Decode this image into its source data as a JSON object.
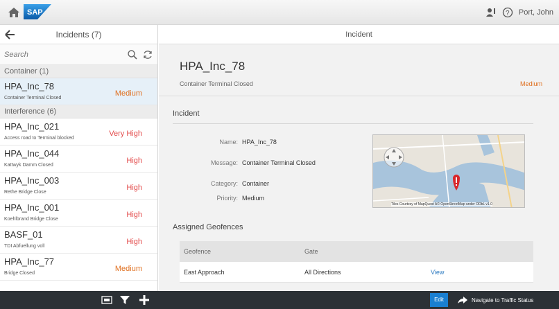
{
  "shell": {
    "logo_text": "SAP",
    "user_name": "Port, John",
    "icons": [
      "home-icon",
      "user-notification-icon",
      "help-icon"
    ]
  },
  "master": {
    "title": "Incidents (7)",
    "search_placeholder": "Search",
    "groups": [
      {
        "label": "Container (1)",
        "items": [
          {
            "title": "HPA_Inc_78",
            "desc": "Container Terminal Closed",
            "priority": "Medium",
            "selected": true
          }
        ]
      },
      {
        "label": "Interference (6)",
        "items": [
          {
            "title": "HPA_Inc_021",
            "desc": "Access road to Terminal blocked",
            "priority": "Very High"
          },
          {
            "title": "HPA_Inc_044",
            "desc": "Kattwyk Damm Closed",
            "priority": "High"
          },
          {
            "title": "HPA_Inc_003",
            "desc": "Rethe Bridge Close",
            "priority": "High"
          },
          {
            "title": "HPA_Inc_001",
            "desc": "Koehlbrand Bridge Close",
            "priority": "High"
          },
          {
            "title": "BASF_01",
            "desc": "TDI Abfuellung voll",
            "priority": "High"
          },
          {
            "title": "HPA_Inc_77",
            "desc": "Bridge Closed",
            "priority": "Medium"
          }
        ]
      }
    ]
  },
  "detail": {
    "header": "Incident",
    "title": "HPA_Inc_78",
    "subtitle": "Container Terminal Closed",
    "priority": "Medium",
    "section_incident": "Incident",
    "fields": {
      "name_label": "Name:",
      "name_value": "HPA_Inc_78",
      "message_label": "Message:",
      "message_value": "Container Terminal Closed",
      "category_label": "Category:",
      "category_value": "Container",
      "priority_label": "Priority:",
      "priority_value": "Medium"
    },
    "map_credit": "Tiles Courtesy of MapQuest A© OpenStreetMap under ODbL v1.0",
    "section_geofences": "Assigned Geofences",
    "table": {
      "headers": [
        "Geofence",
        "Gate",
        ""
      ],
      "rows": [
        {
          "geofence": "East Approach",
          "gate": "All Directions",
          "action": "View"
        }
      ]
    }
  },
  "footer": {
    "edit_label": "Edit",
    "navigate_label": "Navigate to Traffic Status"
  },
  "colors": {
    "accent": "#1a7fd1",
    "priority_high": "#e34b4b",
    "priority_medium": "#e07020",
    "footer_bg": "#2c3136",
    "selected_bg": "#e6f0f8"
  }
}
